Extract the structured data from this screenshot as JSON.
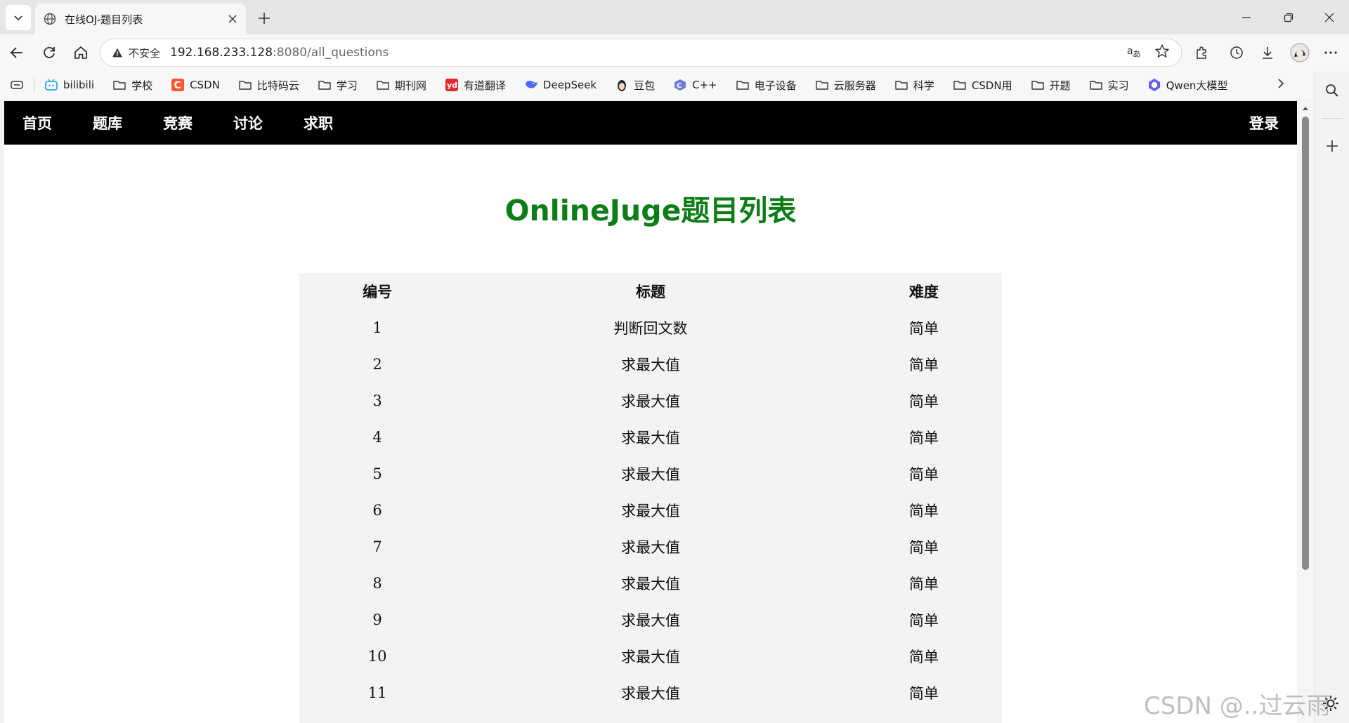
{
  "browser": {
    "tab": {
      "title": "在线OJ-题目列表"
    },
    "address": {
      "security_label": "不安全",
      "host": "192.168.233.128",
      "path": ":8080/all_questions"
    },
    "bookmarks": [
      {
        "label": "bilibili",
        "icon": "bilibili-icon"
      },
      {
        "label": "学校",
        "icon": "folder-icon"
      },
      {
        "label": "CSDN",
        "icon": "csdn-icon"
      },
      {
        "label": "比特码云",
        "icon": "folder-icon"
      },
      {
        "label": "学习",
        "icon": "folder-icon"
      },
      {
        "label": "期刊网",
        "icon": "folder-icon"
      },
      {
        "label": "有道翻译",
        "icon": "youdao-icon"
      },
      {
        "label": "DeepSeek",
        "icon": "deepseek-icon"
      },
      {
        "label": "豆包",
        "icon": "doubao-icon"
      },
      {
        "label": "C++",
        "icon": "cpp-icon"
      },
      {
        "label": "电子设备",
        "icon": "folder-icon"
      },
      {
        "label": "云服务器",
        "icon": "folder-icon"
      },
      {
        "label": "科学",
        "icon": "folder-icon"
      },
      {
        "label": "CSDN用",
        "icon": "folder-icon"
      },
      {
        "label": "开题",
        "icon": "folder-icon"
      },
      {
        "label": "实习",
        "icon": "folder-icon"
      },
      {
        "label": "Qwen大模型",
        "icon": "qwen-icon"
      }
    ],
    "colors": {
      "csdn": "#fc5531",
      "youdao": "#e8252c",
      "deepseek": "#4d6bfe",
      "qwen": "#615ced"
    }
  },
  "page": {
    "nav": {
      "items": [
        "首页",
        "题库",
        "竞赛",
        "讨论",
        "求职"
      ],
      "login": "登录"
    },
    "title": "OnlineJuge题目列表",
    "title_color": "#0d7d17",
    "table": {
      "headers": [
        "编号",
        "标题",
        "难度"
      ],
      "rows": [
        [
          "1",
          "判断回文数",
          "简单"
        ],
        [
          "2",
          "求最大值",
          "简单"
        ],
        [
          "3",
          "求最大值",
          "简单"
        ],
        [
          "4",
          "求最大值",
          "简单"
        ],
        [
          "5",
          "求最大值",
          "简单"
        ],
        [
          "6",
          "求最大值",
          "简单"
        ],
        [
          "7",
          "求最大值",
          "简单"
        ],
        [
          "8",
          "求最大值",
          "简单"
        ],
        [
          "9",
          "求最大值",
          "简单"
        ],
        [
          "10",
          "求最大值",
          "简单"
        ],
        [
          "11",
          "求最大值",
          "简单"
        ]
      ]
    }
  },
  "watermark": "CSDN @..过云雨"
}
